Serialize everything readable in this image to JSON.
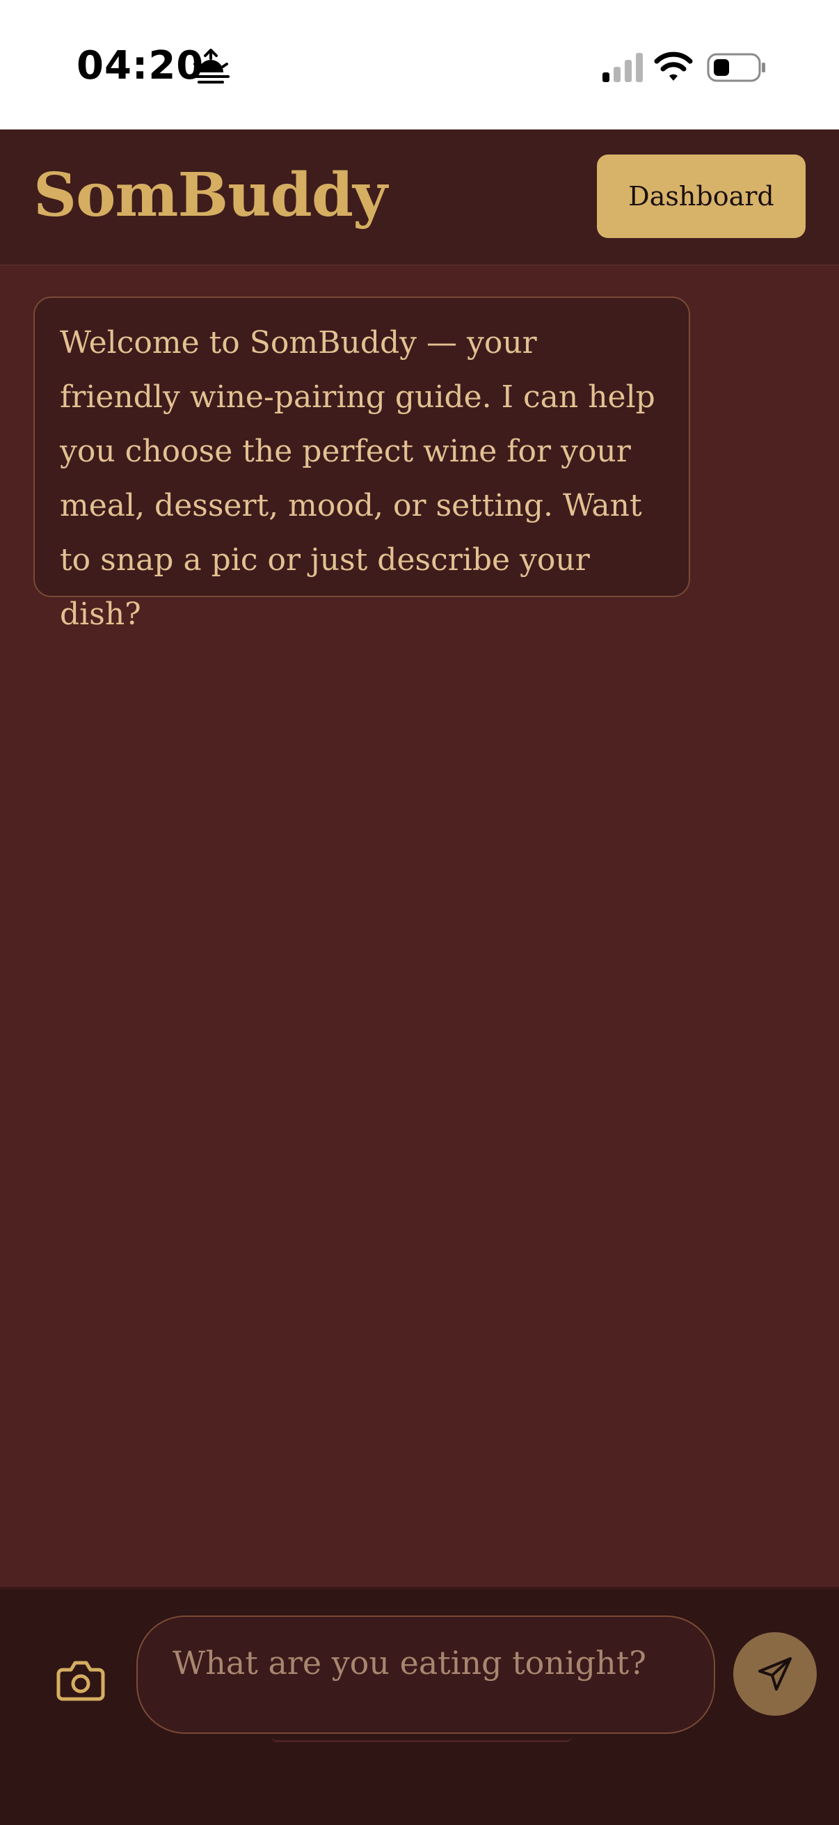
{
  "status_bar": {
    "time": "04:20"
  },
  "header": {
    "app_title": "SomBuddy",
    "dashboard_label": "Dashboard"
  },
  "chat": {
    "messages": [
      {
        "role": "assistant",
        "text": "Welcome to SomBuddy — your friendly wine-pairing guide. I can help you choose the perfect wine for your meal, dessert, mood, or setting. Want to snap a pic or just describe your dish?"
      }
    ]
  },
  "composer": {
    "placeholder": "What are you eating tonight?",
    "value": "",
    "camera_icon": "camera-icon",
    "send_icon": "send-icon"
  },
  "colors": {
    "background": "#4d2220",
    "header": "#3f1d1c",
    "accent": "#d7b36a",
    "text": "#e3c192"
  }
}
